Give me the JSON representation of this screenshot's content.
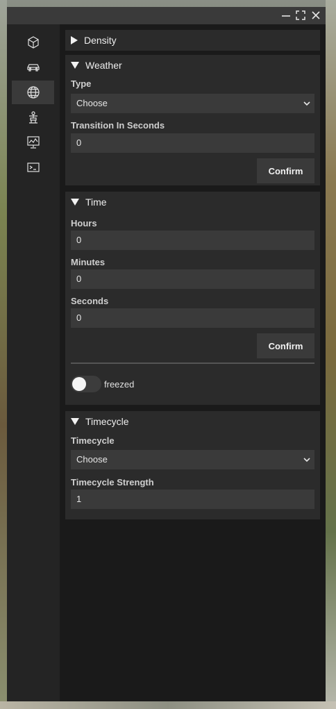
{
  "icons": {
    "minimize": "minimize-icon",
    "maximize": "maximize-icon",
    "close": "close-icon"
  },
  "sidebar": {
    "items": [
      {
        "icon": "cube-icon",
        "active": false
      },
      {
        "icon": "car-icon",
        "active": false
      },
      {
        "icon": "globe-icon",
        "active": true
      },
      {
        "icon": "ped-icon",
        "active": false
      },
      {
        "icon": "monitor-chart-icon",
        "active": false
      },
      {
        "icon": "terminal-icon",
        "active": false
      }
    ]
  },
  "density": {
    "title": "Density"
  },
  "weather": {
    "title": "Weather",
    "type_label": "Type",
    "type_value": "Choose",
    "transition_label": "Transition In Seconds",
    "transition_value": "0",
    "confirm_label": "Confirm"
  },
  "time": {
    "title": "Time",
    "hours_label": "Hours",
    "hours_value": "0",
    "minutes_label": "Minutes",
    "minutes_value": "0",
    "seconds_label": "Seconds",
    "seconds_value": "0",
    "confirm_label": "Confirm",
    "freeze_label": "freezed",
    "freeze_on": false
  },
  "timecycle": {
    "title": "Timecycle",
    "timecycle_label": "Timecycle",
    "timecycle_value": "Choose",
    "strength_label": "Timecycle Strength",
    "strength_value": "1"
  },
  "colors": {
    "titlebar": "#3a3a3a",
    "sidebar": "#242424",
    "panel": "#2b2b2b",
    "field": "#3a3a3a",
    "content_bg": "#1a1a1a"
  }
}
